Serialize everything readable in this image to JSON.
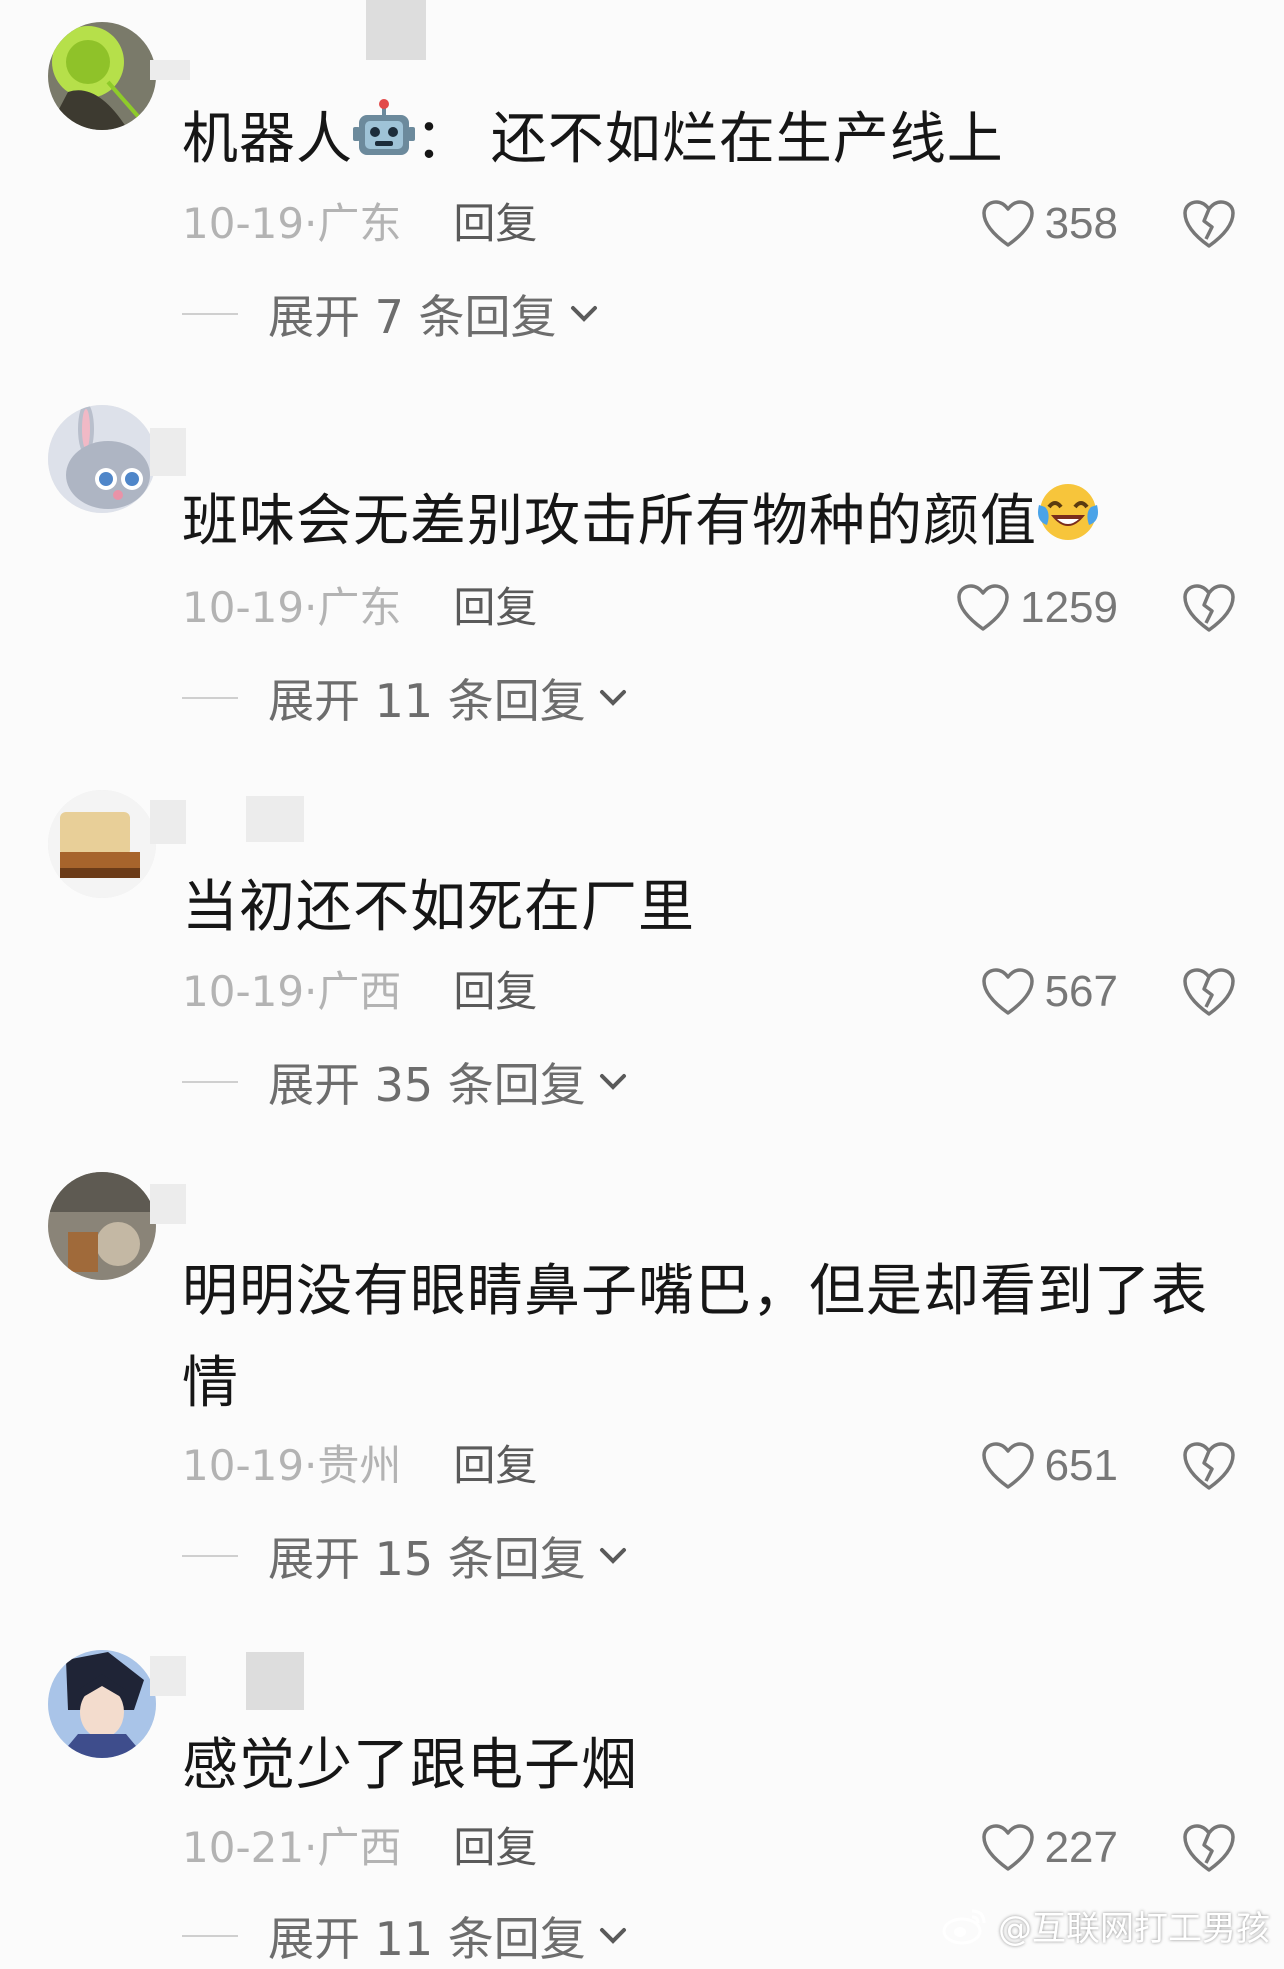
{
  "comments": [
    {
      "text": "机器人",
      "text_after_emoji": "：  还不如烂在生产线上",
      "emoji": "robot-emoji",
      "date": "10-19·",
      "location": "广东",
      "reply_label": "回复",
      "likes": "358",
      "expand_label": "展开 7 条回复"
    },
    {
      "text": "班味会无差别攻击所有物种的颜值",
      "emoji": "laughing-crying-emoji",
      "date": "10-19·",
      "location": "广东",
      "reply_label": "回复",
      "likes": "1259",
      "expand_label": "展开 11 条回复"
    },
    {
      "text": "当初还不如死在厂里",
      "date": "10-19·",
      "location": "广西",
      "reply_label": "回复",
      "likes": "567",
      "expand_label": "展开 35 条回复"
    },
    {
      "text": "明明没有眼睛鼻子嘴巴，但是却看到了表情",
      "date": "10-19·",
      "location": "贵州",
      "reply_label": "回复",
      "likes": "651",
      "expand_label": "展开 15 条回复"
    },
    {
      "text": "感觉少了跟电子烟",
      "date": "10-21·",
      "location": "广西",
      "reply_label": "回复",
      "likes": "227",
      "expand_label": "展开 11 条回复"
    }
  ],
  "watermark": "@互联网打工男孩",
  "colors": {
    "background": "#fbfbfb",
    "text": "#161616",
    "meta": "#b3b3b3",
    "reply": "#5a5a5a"
  }
}
